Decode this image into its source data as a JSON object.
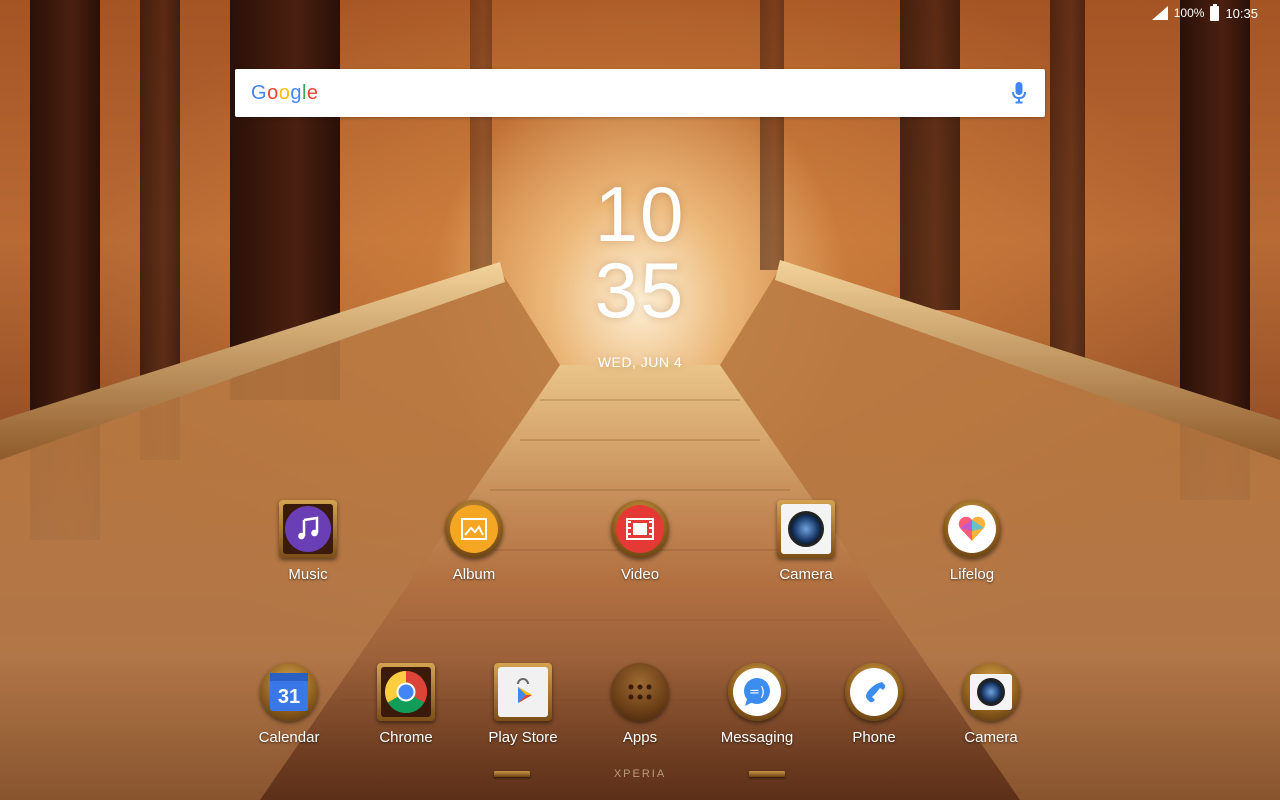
{
  "status_bar": {
    "battery_percent": "100%",
    "time": "10:35"
  },
  "search": {
    "logo_letters": [
      "G",
      "o",
      "o",
      "g",
      "l",
      "e"
    ],
    "mic_icon": "microphone-icon"
  },
  "clock": {
    "hours": "10",
    "minutes": "35",
    "date": "WED, JUN 4"
  },
  "home_apps": [
    {
      "label": "Music",
      "icon": "music-icon",
      "accent": "#6a3fb5"
    },
    {
      "label": "Album",
      "icon": "album-icon",
      "accent": "#f5a623"
    },
    {
      "label": "Video",
      "icon": "video-icon",
      "accent": "#e53935"
    },
    {
      "label": "Camera",
      "icon": "camera-icon",
      "accent": "#1a3a6a"
    },
    {
      "label": "Lifelog",
      "icon": "lifelog-icon",
      "accent": "#ff5a5a"
    }
  ],
  "dock_apps": [
    {
      "label": "Calendar",
      "icon": "calendar-icon",
      "day": "31",
      "accent": "#3b78e7"
    },
    {
      "label": "Chrome",
      "icon": "chrome-icon",
      "accent": "#4285f4"
    },
    {
      "label": "Play Store",
      "icon": "play-store-icon",
      "accent": "#34a853"
    },
    {
      "label": "Apps",
      "icon": "apps-grid-icon",
      "accent": "#6b3e16"
    },
    {
      "label": "Messaging",
      "icon": "messaging-icon",
      "accent": "#3b8ef0"
    },
    {
      "label": "Phone",
      "icon": "phone-icon",
      "accent": "#3b8ef0"
    },
    {
      "label": "Camera",
      "icon": "camera-icon",
      "accent": "#1a3a6a"
    }
  ],
  "brand": "XPERIA"
}
